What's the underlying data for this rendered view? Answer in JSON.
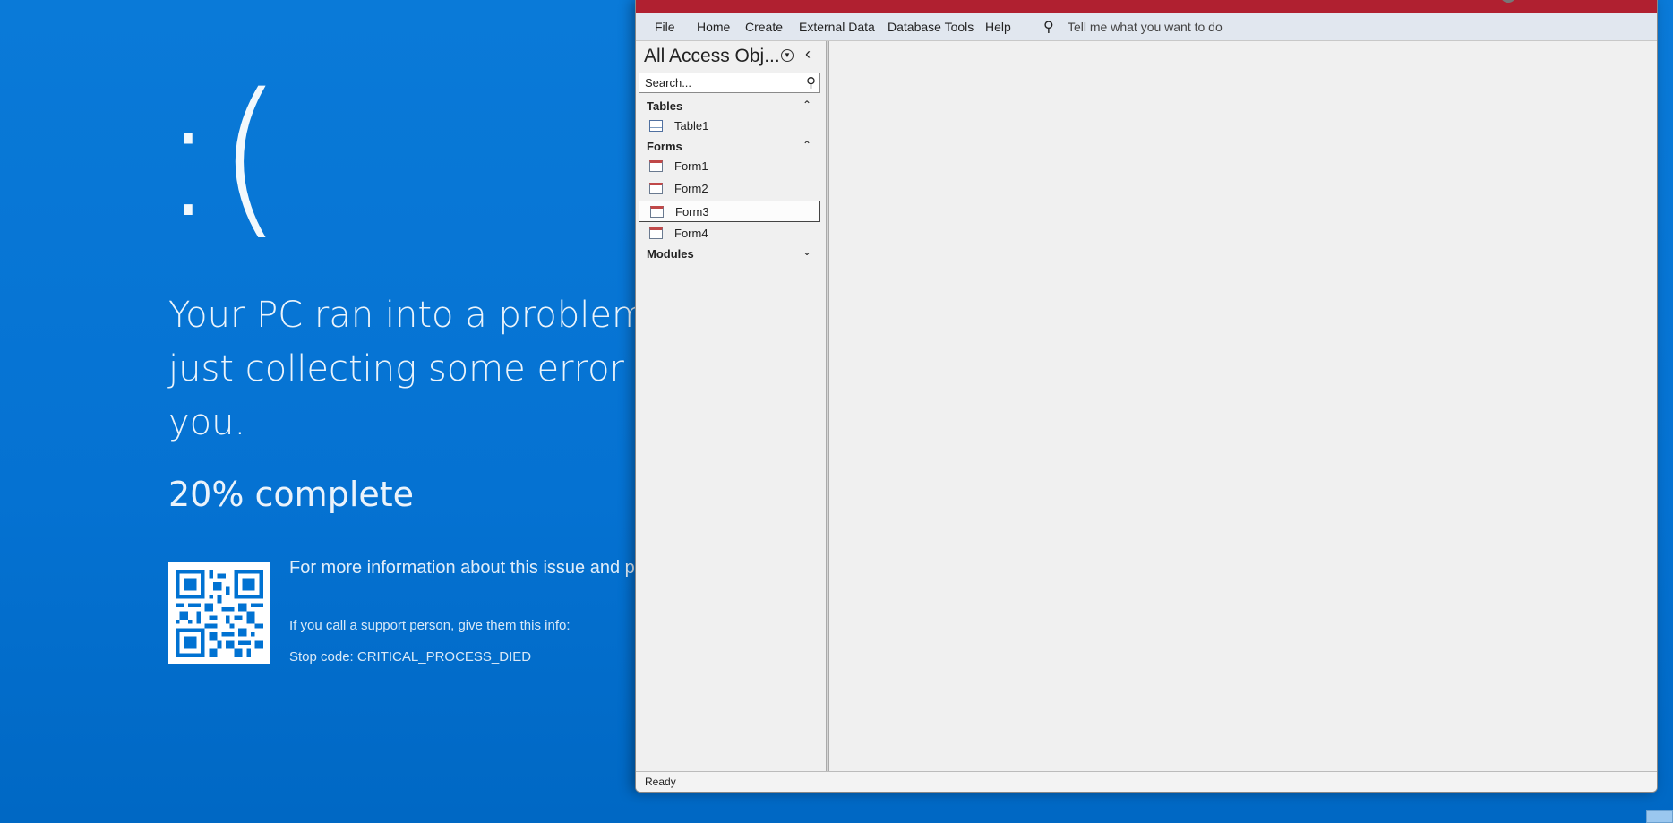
{
  "bsod": {
    "face": ":(",
    "message": "Your PC ran into a problem and\njust collecting some error info\nyou.",
    "progress": "20% complete",
    "progress_percent": 20,
    "more_info": "For more information about this issue and pos",
    "support": "If you call a support person, give them this info:",
    "stop_code": "Stop code: CRITICAL_PROCESS_DIED"
  },
  "access": {
    "menu": [
      "File",
      "Home",
      "Create",
      "External Data",
      "Database Tools",
      "Help"
    ],
    "tell_me": "Tell me what you want to do",
    "nav": {
      "title": "All Access Obj...",
      "search_placeholder": "Search...",
      "groups": {
        "tables": {
          "label": "Tables",
          "items": [
            "Table1"
          ]
        },
        "forms": {
          "label": "Forms",
          "items": [
            "Form1",
            "Form2",
            "Form3",
            "Form4"
          ]
        },
        "modules": {
          "label": "Modules"
        }
      },
      "selected": "Form3"
    },
    "status": "Ready",
    "accent": "#b02030"
  }
}
